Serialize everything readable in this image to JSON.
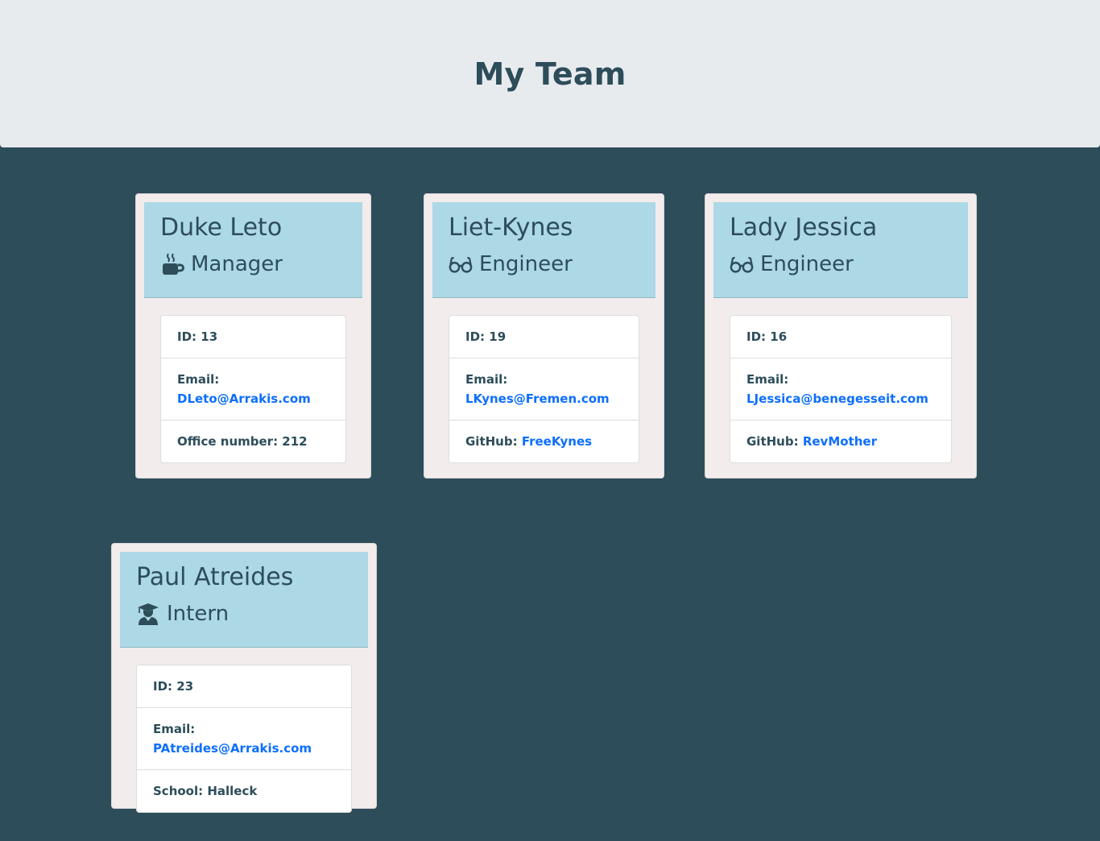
{
  "header": {
    "title": "My Team"
  },
  "team": [
    {
      "name": "Duke Leto",
      "role": "Manager",
      "icon": "coffee-mug-icon",
      "id_label": "ID: 13",
      "email_label": "Email:",
      "email": "DLeto@Arrakis.com",
      "extra_label": "Office number: 212",
      "extra_link": ""
    },
    {
      "name": "Liet-Kynes",
      "role": "Engineer",
      "icon": "glasses-icon",
      "id_label": "ID: 19",
      "email_label": "Email:",
      "email": "LKynes@Fremen.com",
      "extra_label": "GitHub:",
      "extra_link": "FreeKynes"
    },
    {
      "name": "Lady Jessica",
      "role": "Engineer",
      "icon": "glasses-icon",
      "id_label": "ID: 16",
      "email_label": "Email:",
      "email": "LJessica@benegesseit.com",
      "extra_label": "GitHub:",
      "extra_link": "RevMother"
    },
    {
      "name": "Paul Atreides",
      "role": "Intern",
      "icon": "graduate-icon",
      "id_label": "ID: 23",
      "email_label": "Email:",
      "email": "PAtreides@Arrakis.com",
      "extra_label": "School: Halleck",
      "extra_link": ""
    }
  ],
  "colors": {
    "background": "#2d4d5a",
    "header_bg": "#e8ebee",
    "card_bg": "#f2ecec",
    "card_head_bg": "#add8e6",
    "link": "#0d6efd"
  }
}
